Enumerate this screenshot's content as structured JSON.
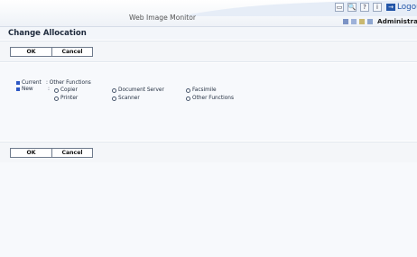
{
  "header": {
    "app_title": "Web Image Monitor",
    "logout_label": "Logout",
    "user_name": "Administrator",
    "top_icons": [
      "help-icon",
      "search-icon",
      "question-icon",
      "info-icon"
    ]
  },
  "page": {
    "title": "Change Allocation"
  },
  "buttons": {
    "ok": "OK",
    "cancel": "Cancel"
  },
  "allocation": {
    "current_label": "Current",
    "current_value": ": Other Functions",
    "new_label": "New",
    "new_colon": ":",
    "options": [
      {
        "label": "Copier"
      },
      {
        "label": "Document Server"
      },
      {
        "label": "Facsimile"
      },
      {
        "label": "Printer"
      },
      {
        "label": "Scanner"
      },
      {
        "label": "Other Functions"
      }
    ]
  },
  "colors": {
    "accent": "#2c57c4",
    "panel": "#f4f6f9",
    "border": "#6e7a8c"
  }
}
